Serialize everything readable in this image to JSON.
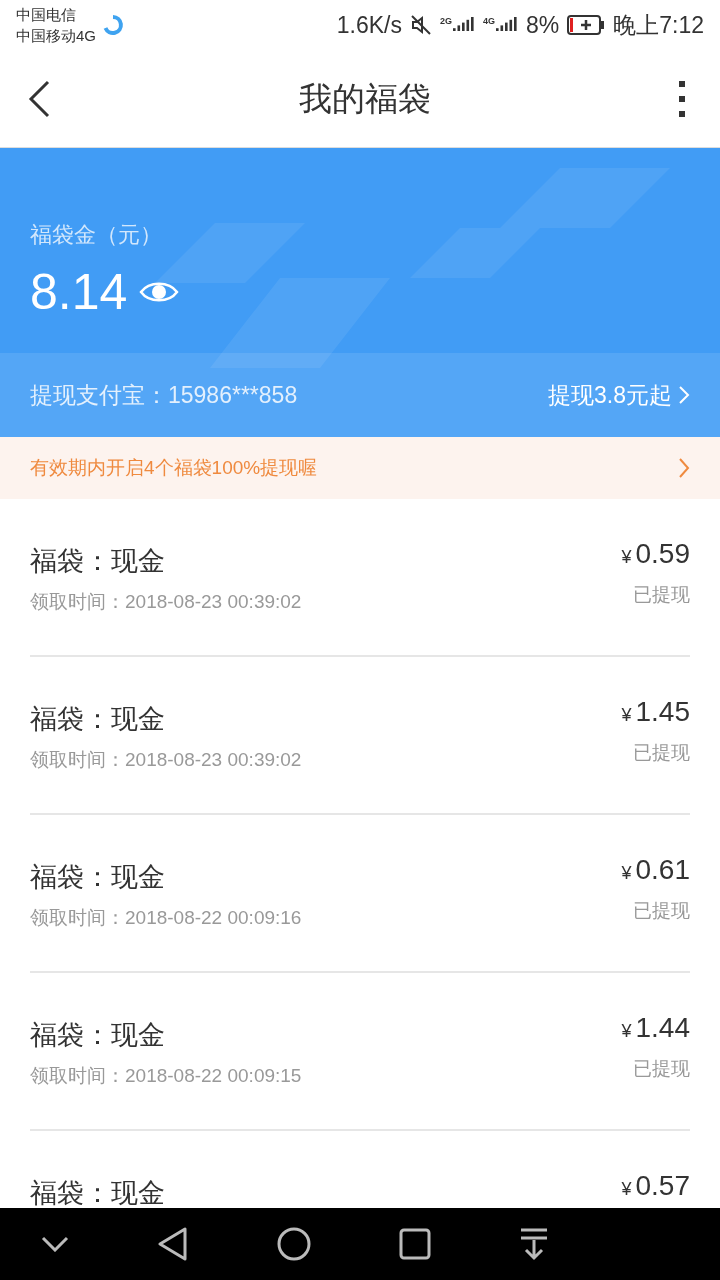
{
  "status_bar": {
    "carriers": [
      "中国电信",
      "中国移动4G"
    ],
    "speed": "1.6K/s",
    "sim1": "2G",
    "sim2": "4G",
    "battery": "8%",
    "time": "晚上7:12"
  },
  "header": {
    "title": "我的福袋"
  },
  "balance": {
    "label": "福袋金（元）",
    "amount": "8.14"
  },
  "withdraw": {
    "account": "提现支付宝：15986***858",
    "action": "提现3.8元起"
  },
  "notice": {
    "text": "有效期内开启4个福袋100%提现喔"
  },
  "records": [
    {
      "title": "福袋：现金",
      "time": "领取时间：2018-08-23 00:39:02",
      "currency": "¥",
      "amount": "0.59",
      "status": "已提现"
    },
    {
      "title": "福袋：现金",
      "time": "领取时间：2018-08-23 00:39:02",
      "currency": "¥",
      "amount": "1.45",
      "status": "已提现"
    },
    {
      "title": "福袋：现金",
      "time": "领取时间：2018-08-22 00:09:16",
      "currency": "¥",
      "amount": "0.61",
      "status": "已提现"
    },
    {
      "title": "福袋：现金",
      "time": "领取时间：2018-08-22 00:09:15",
      "currency": "¥",
      "amount": "1.44",
      "status": "已提现"
    },
    {
      "title": "福袋：现金",
      "currency": "¥",
      "amount": "0.57"
    }
  ]
}
